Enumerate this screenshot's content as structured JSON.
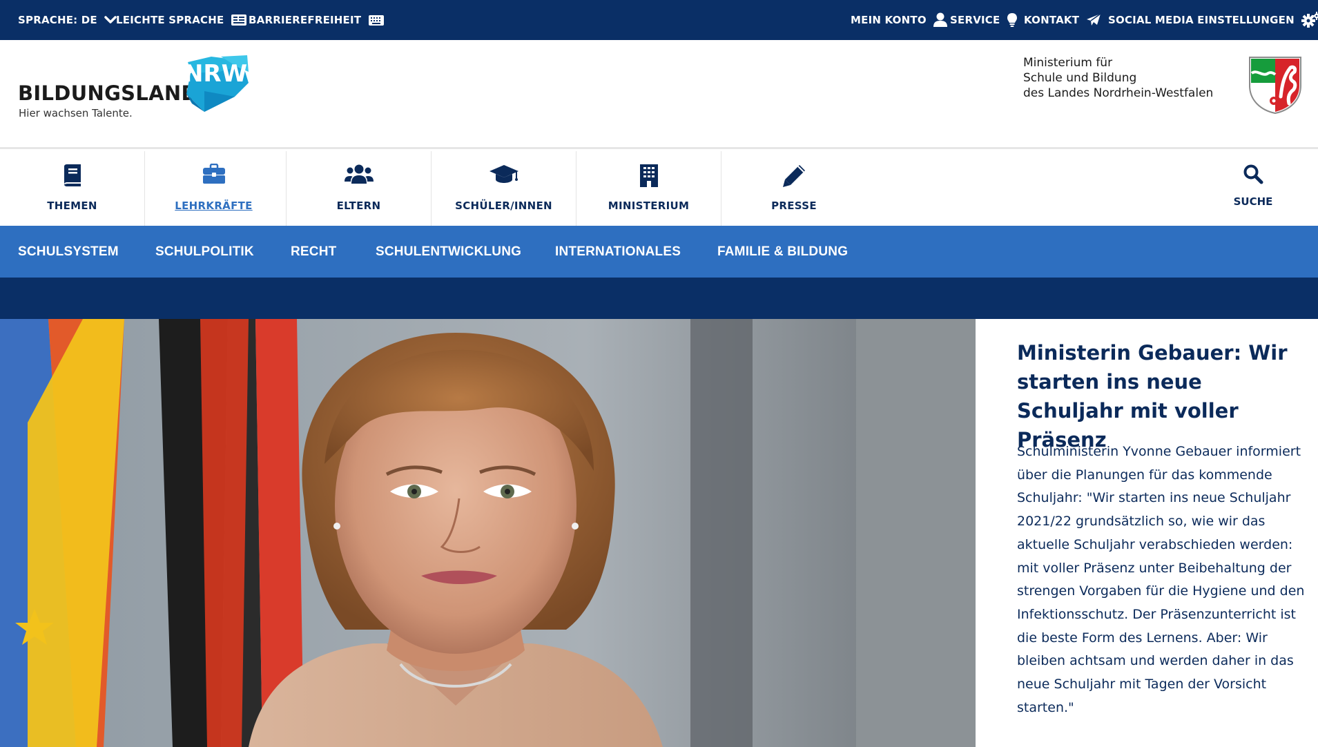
{
  "topbar": {
    "language": "SPRACHE: DE",
    "easy_language": "LEICHTE SPRACHE",
    "accessibility": "BARRIEREFREIHEIT",
    "account": "MEIN KONTO",
    "service": "SERVICE",
    "contact": "KONTAKT",
    "social": "SOCIAL MEDIA EINSTELLUNGEN"
  },
  "logo": {
    "word": "BILDUNGSLAND",
    "mark": "NRW",
    "tagline": "Hier wachsen Talente."
  },
  "ministry": {
    "line1": "Ministerium für",
    "line2": "Schule und Bildung",
    "line3": "des Landes Nordrhein-Westfalen"
  },
  "mainnav": {
    "items": [
      {
        "label": "THEMEN",
        "icon": "book-icon"
      },
      {
        "label": "LEHRKRÄFTE",
        "icon": "briefcase-icon"
      },
      {
        "label": "ELTERN",
        "icon": "users-icon"
      },
      {
        "label": "SCHÜLER/INNEN",
        "icon": "graduation-cap-icon"
      },
      {
        "label": "MINISTERIUM",
        "icon": "building-icon"
      },
      {
        "label": "PRESSE",
        "icon": "pencil-icon"
      }
    ],
    "search": "SUCHE"
  },
  "subnav": {
    "items": [
      "SCHULSYSTEM",
      "SCHULPOLITIK",
      "RECHT",
      "SCHULENTWICKLUNG",
      "INTERNATIONALES",
      "FAMILIE & BILDUNG"
    ]
  },
  "hero": {
    "title": "Ministerin Gebauer: Wir starten ins neue Schuljahr mit voller Präsenz",
    "body": "Schulministerin Yvonne Gebauer informiert über die Planungen für das kommende Schuljahr: \"Wir starten ins neue Schuljahr 2021/22 grundsätzlich so, wie wir das aktuelle Schuljahr verabschieden werden: mit voller Präsenz unter Beibehaltung der strengen Vorgaben für die Hygiene und den Infektionsschutz. Der Präsenzunterricht ist die beste Form des Lernens. Aber: Wir bleiben achtsam und werden daher in das neue Schuljahr mit Tagen der Vorsicht starten.\""
  },
  "colors": {
    "topbar": "#0a2f66",
    "subnav": "#2e6fc0",
    "text": "#0b2a5a",
    "active": "#2e6fc0"
  }
}
